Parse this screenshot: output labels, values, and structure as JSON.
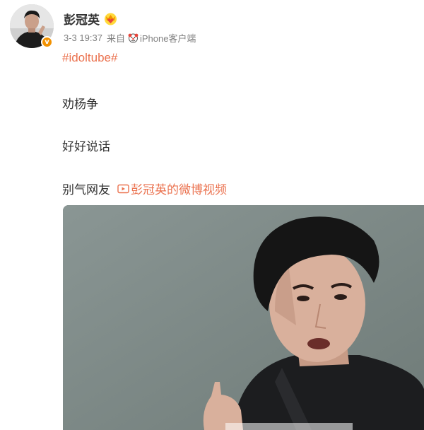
{
  "post": {
    "author": "彭冠英",
    "timestamp": "3-3 19:37",
    "source_prefix": "来自",
    "source_device": "iPhone客户端",
    "hashtag": "#idoltube#",
    "lines": [
      "劝杨争",
      "好好说话",
      "别气网友"
    ],
    "video_link_label": "彭冠英的微博视频",
    "icons": {
      "avatar_badge": "v-badge-icon",
      "member": "crown-heart-icon",
      "device": "clown-face-icon",
      "video_link": "video-play-icon"
    },
    "colors": {
      "link": "#eb7350",
      "text": "#333333",
      "meta": "#808080",
      "badge": "#f29100"
    }
  }
}
